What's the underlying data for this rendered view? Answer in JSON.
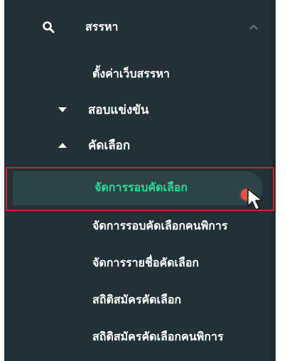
{
  "menu": {
    "search_group": {
      "label": "สรรหา",
      "icon": "search-icon",
      "chevron": "chevron-up-icon"
    },
    "settings_item": {
      "label": "ตั้งค่าเว็บสรรหา"
    },
    "competition_group": {
      "label": "สอบแข่งขัน",
      "toggle_icon": "triangle-down-icon"
    },
    "selection_group": {
      "label": "คัดเลือก",
      "toggle_icon": "triangle-up-icon"
    },
    "selection_items": [
      {
        "label": "จัดการรอบคัดเลือก",
        "selected": true
      },
      {
        "label": "จัดการรอบคัดเลือกคนพิการ",
        "selected": false
      },
      {
        "label": "จัดการรายชื่อคัดเลือก",
        "selected": false
      },
      {
        "label": "สถิติสมัครคัดเลือก",
        "selected": false
      },
      {
        "label": "สถิติสมัครคัดเลือกคนพิการ",
        "selected": false
      }
    ]
  },
  "colors": {
    "sidebar_bg": "#223037",
    "selected_bg": "#2c4448",
    "selected_text": "#2edb9c",
    "highlight_border": "#c62828",
    "cursor_dot": "#e55344",
    "text": "#ffffff"
  }
}
